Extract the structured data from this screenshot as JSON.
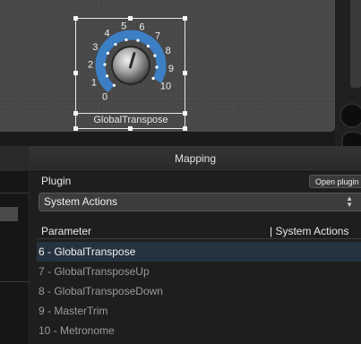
{
  "knob": {
    "ticks": [
      "0",
      "1",
      "2",
      "3",
      "4",
      "5",
      "6",
      "7",
      "8",
      "9",
      "10"
    ],
    "label": "GlobalTranspose",
    "value_fraction": 0.6
  },
  "mapping": {
    "title": "Mapping",
    "plugin_label": "Plugin",
    "open_plugin_button": "Open plugin",
    "plugin_select_value": "System Actions",
    "param_header": "Parameter",
    "param_header_right": "| System Actions",
    "params": [
      {
        "label": "6 - GlobalTranspose",
        "selected": true
      },
      {
        "label": "7 - GlobalTransposeUp",
        "selected": false
      },
      {
        "label": "8 - GlobalTransposeDown",
        "selected": false
      },
      {
        "label": "9 - MasterTrim",
        "selected": false
      },
      {
        "label": "10 - Metronome",
        "selected": false
      }
    ]
  },
  "colors": {
    "knob_ring": "#3d7fc4",
    "selection": "#253240"
  },
  "icons": [
    "chevron-updown-icon"
  ]
}
